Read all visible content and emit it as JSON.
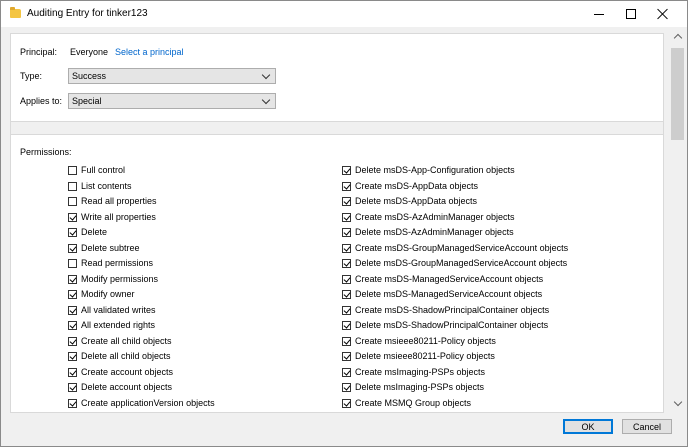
{
  "window": {
    "title": "Auditing Entry for tinker123"
  },
  "principal": {
    "label": "Principal:",
    "value": "Everyone",
    "select_link": "Select a principal"
  },
  "type": {
    "label": "Type:",
    "selected": "Success"
  },
  "applies_to": {
    "label": "Applies to:",
    "selected": "Special"
  },
  "permissions": {
    "heading": "Permissions:",
    "left": [
      {
        "label": "Full control",
        "checked": false
      },
      {
        "label": "List contents",
        "checked": false
      },
      {
        "label": "Read all properties",
        "checked": false
      },
      {
        "label": "Write all properties",
        "checked": true
      },
      {
        "label": "Delete",
        "checked": true
      },
      {
        "label": "Delete subtree",
        "checked": true
      },
      {
        "label": "Read permissions",
        "checked": false
      },
      {
        "label": "Modify permissions",
        "checked": true
      },
      {
        "label": "Modify owner",
        "checked": true
      },
      {
        "label": "All validated writes",
        "checked": true
      },
      {
        "label": "All extended rights",
        "checked": true
      },
      {
        "label": "Create all child objects",
        "checked": true
      },
      {
        "label": "Delete all child objects",
        "checked": true
      },
      {
        "label": "Create account objects",
        "checked": true
      },
      {
        "label": "Delete account objects",
        "checked": true
      },
      {
        "label": "Create applicationVersion objects",
        "checked": true
      }
    ],
    "right": [
      {
        "label": "Delete msDS-App-Configuration objects",
        "checked": true
      },
      {
        "label": "Create msDS-AppData objects",
        "checked": true
      },
      {
        "label": "Delete msDS-AppData objects",
        "checked": true
      },
      {
        "label": "Create msDS-AzAdminManager objects",
        "checked": true
      },
      {
        "label": "Delete msDS-AzAdminManager objects",
        "checked": true
      },
      {
        "label": "Create msDS-GroupManagedServiceAccount objects",
        "checked": true
      },
      {
        "label": "Delete msDS-GroupManagedServiceAccount objects",
        "checked": true
      },
      {
        "label": "Create msDS-ManagedServiceAccount objects",
        "checked": true
      },
      {
        "label": "Delete msDS-ManagedServiceAccount objects",
        "checked": true
      },
      {
        "label": "Create msDS-ShadowPrincipalContainer objects",
        "checked": true
      },
      {
        "label": "Delete msDS-ShadowPrincipalContainer objects",
        "checked": true
      },
      {
        "label": "Create msieee80211-Policy objects",
        "checked": true
      },
      {
        "label": "Delete msieee80211-Policy objects",
        "checked": true
      },
      {
        "label": "Create msImaging-PSPs objects",
        "checked": true
      },
      {
        "label": "Delete msImaging-PSPs objects",
        "checked": true
      },
      {
        "label": "Create MSMQ Group objects",
        "checked": true
      }
    ]
  },
  "buttons": {
    "ok": "OK",
    "cancel": "Cancel"
  },
  "icons": {
    "folder": "folder-icon",
    "minimize": "minimize-icon",
    "maximize": "maximize-icon",
    "close": "close-icon",
    "dropdown": "chevron-down-icon",
    "checkbox": "checkbox-icon"
  },
  "colors": {
    "link": "#0066cc",
    "focus_border": "#0078d7",
    "folder": "#f4c542"
  }
}
